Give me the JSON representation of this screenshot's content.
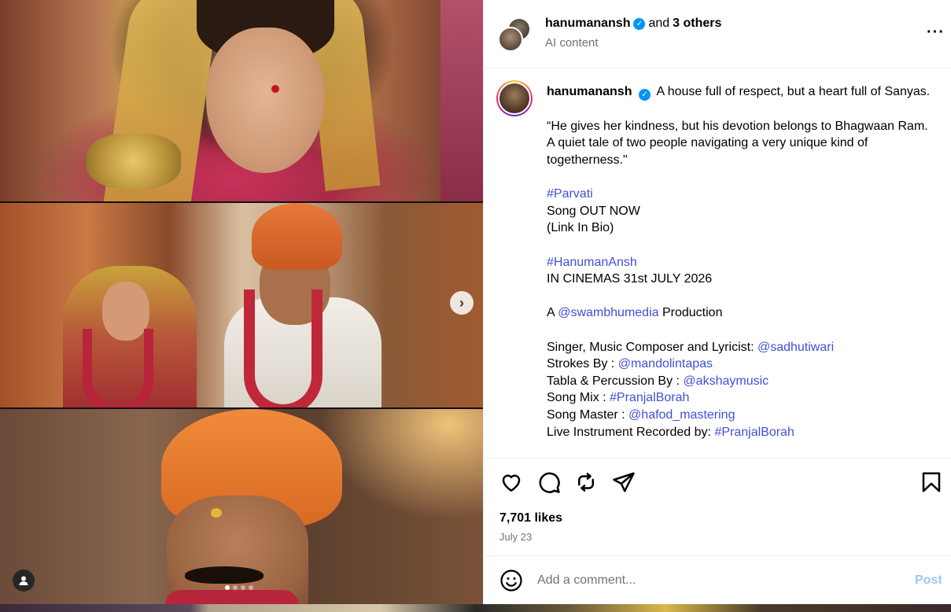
{
  "header": {
    "username": "hanumanansh",
    "and_text": "and",
    "others": "3 others",
    "subtitle": "AI content"
  },
  "caption": {
    "username": "hanumanansh",
    "lines": [
      {
        "text": "A house full of respect, but a heart full of Sanyas."
      },
      {
        "text": "“He gives her kindness, but his devotion belongs to Bhagwaan Ram. A quiet tale of two people navigating a very unique kind of togetherness.\""
      },
      {
        "hashtag": "#Parvati"
      },
      {
        "text": "Song OUT NOW"
      },
      {
        "text": "(Link In Bio)"
      },
      {
        "hashtag": "#HanumanAnsh"
      },
      {
        "text": "IN CINEMAS 31st JULY 2026"
      },
      {
        "prefix": "A ",
        "mention": "@swambhumedia",
        "suffix": " Production"
      },
      {
        "prefix": "Singer, Music Composer and Lyricist: ",
        "mention": "@sadhutiwari"
      },
      {
        "prefix": "Strokes By : ",
        "mention": "@mandolintapas"
      },
      {
        "prefix": "Tabla & Percussion By : ",
        "mention": "@akshaymusic"
      },
      {
        "prefix": "Song Mix : ",
        "mention": "#PranjalBorah"
      },
      {
        "prefix": "Song Master : ",
        "mention": "@hafod_mastering"
      },
      {
        "prefix": "Live Instrument Recorded by: ",
        "mention": "#PranjalBorah"
      }
    ]
  },
  "actions": {
    "icons": [
      "heart-icon",
      "comment-icon",
      "repost-icon",
      "share-icon",
      "save-icon"
    ],
    "likes": "7,701 likes",
    "date": "July 23"
  },
  "comment": {
    "placeholder": "Add a comment...",
    "post_label": "Post"
  },
  "media": {
    "slide_count": 4,
    "active_slide": 1
  },
  "colors": {
    "link": "#4150d7",
    "verified": "#0095f6",
    "post_disabled": "#9bc7f4",
    "muted": "#737373"
  }
}
